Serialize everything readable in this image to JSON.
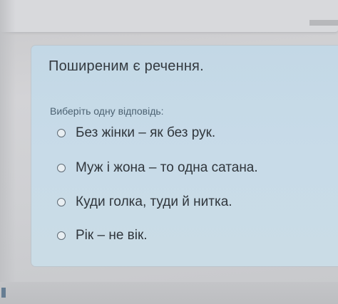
{
  "question": {
    "title": "Поширеним є речення.",
    "prompt": "Виберіть одну відповідь:",
    "options": [
      {
        "label": "Без жінки – як без рук.",
        "selected": false
      },
      {
        "label": "Муж і жона – то одна сатана.",
        "selected": false
      },
      {
        "label": "Куди голка, туди й нитка.",
        "selected": false
      },
      {
        "label": "Рік – не вік.",
        "selected": false
      }
    ]
  },
  "colors": {
    "card_background": "#c8dbe8",
    "page_background": "#d0d1d4",
    "title_text": "#343a40",
    "prompt_text": "#4c6272"
  },
  "icons": {
    "option_marker": "radio-button-icon"
  }
}
